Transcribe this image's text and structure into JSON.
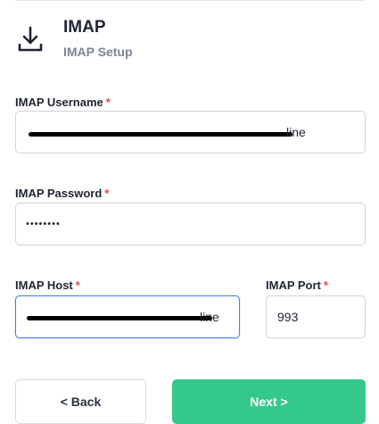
{
  "header": {
    "icon": "download-icon",
    "title": "IMAP",
    "subtitle": "IMAP Setup"
  },
  "form": {
    "username": {
      "label": "IMAP Username",
      "required_mark": "*",
      "value_visible_suffix": "line"
    },
    "password": {
      "label": "IMAP Password",
      "required_mark": "*",
      "value_masked": "••••••••"
    },
    "host": {
      "label": "IMAP Host",
      "required_mark": "*",
      "value_visible_suffix": "line",
      "focused": true
    },
    "port": {
      "label": "IMAP Port",
      "required_mark": "*",
      "value": "993"
    }
  },
  "actions": {
    "back_label": "< Back",
    "next_label": "Next >"
  },
  "colors": {
    "accent_green": "#34c98b",
    "required_red": "#e5484d",
    "focus_blue": "#3b82f6",
    "subtitle_gray": "#7c8595"
  }
}
